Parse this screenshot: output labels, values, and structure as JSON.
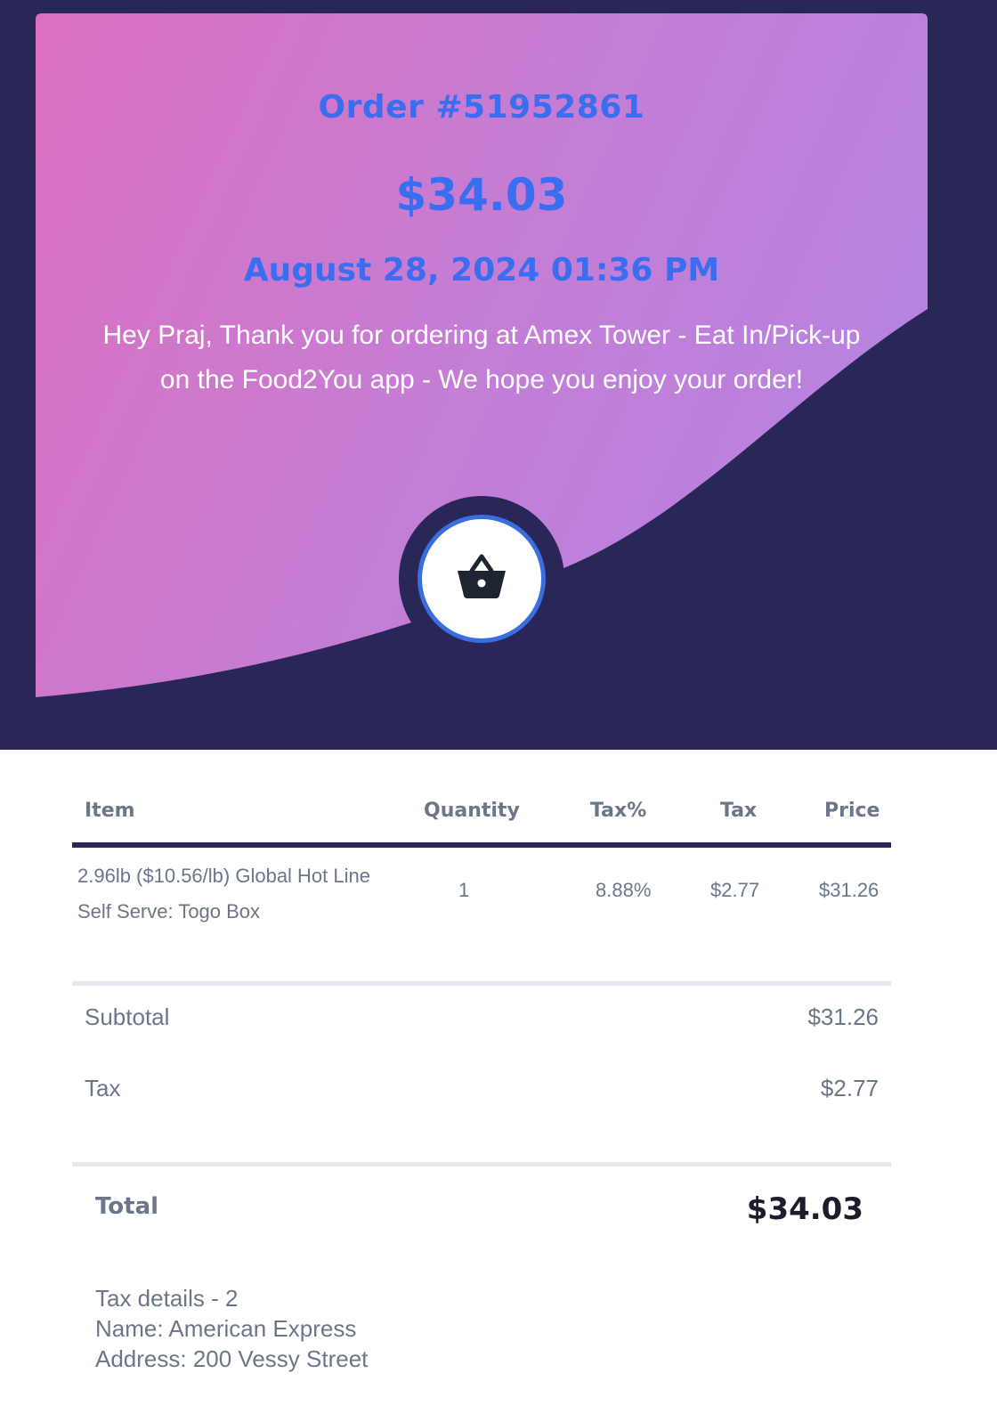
{
  "header": {
    "order_number": "Order #51952861",
    "amount": "$34.03",
    "date": "August 28, 2024 01:36 PM",
    "greeting": "Hey Praj, Thank you for ordering at Amex Tower - Eat In/Pick-up on the Food2You app - We hope you enjoy your order!",
    "badge_icon": "basket-icon"
  },
  "table": {
    "headers": {
      "item": "Item",
      "quantity": "Quantity",
      "tax_pct": "Tax%",
      "tax": "Tax",
      "price": "Price"
    },
    "rows": [
      {
        "item": "2.96lb ($10.56/lb) Global Hot Line Self Serve: Togo Box",
        "quantity": "1",
        "tax_pct": "8.88%",
        "tax": "$2.77",
        "price": "$31.26"
      }
    ]
  },
  "summary": {
    "subtotal_label": "Subtotal",
    "subtotal_value": "$31.26",
    "tax_label": "Tax",
    "tax_value": "$2.77",
    "total_label": "Total",
    "total_value": "$34.03"
  },
  "tax_details": {
    "line1": "Tax details - 2",
    "line2": "Name: American Express",
    "line3": "Address: 200 Vessy Street"
  },
  "colors": {
    "background_dark": "#292658",
    "gradient_start": "#dc6fc0",
    "gradient_end": "#b882e0",
    "accent_blue": "#3a6ef0"
  }
}
